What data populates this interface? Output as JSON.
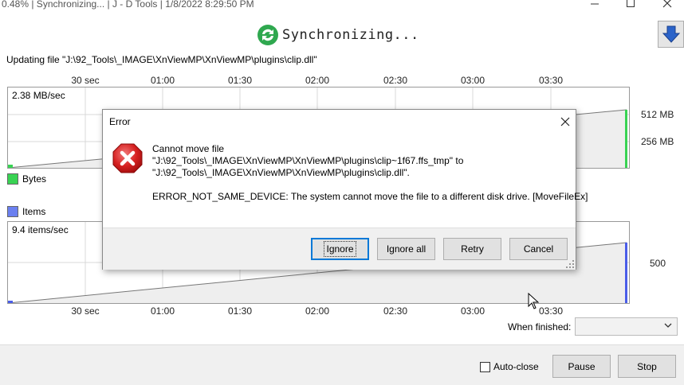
{
  "window": {
    "title": "0.48% | Synchronizing... | J - D Tools | 1/8/2022 8:29:50 PM",
    "minimize_icon": "minimize-icon",
    "maximize_icon": "maximize-icon",
    "close_icon": "close-icon"
  },
  "header": {
    "status_title": "Synchronizing...",
    "sync_icon": "sync-arrows-icon",
    "download_icon": "arrow-down-icon"
  },
  "progress": {
    "updating_text": "Updating file \"J:\\92_Tools\\_IMAGE\\XnViewMP\\XnViewMP\\plugins\\clip.dll\"",
    "time_ticks": [
      "30 sec",
      "01:00",
      "01:30",
      "02:00",
      "02:30",
      "03:00",
      "03:30"
    ],
    "bytes_graph": {
      "rate": "2.38 MB/sec",
      "legend": "Bytes",
      "color": "#39d353",
      "labels": [
        "512 MB",
        "256 MB"
      ]
    },
    "items_graph": {
      "rate": "9.4 items/sec",
      "legend": "Items",
      "color": "#4a5de8",
      "labels": [
        "500"
      ]
    }
  },
  "footer": {
    "when_finished_label": "When finished:",
    "when_finished_value": "",
    "auto_close_label": "Auto-close",
    "auto_close_checked": false,
    "pause_label": "Pause",
    "stop_label": "Stop"
  },
  "dialog": {
    "title": "Error",
    "icon": "error-x-icon",
    "line1": "Cannot move file",
    "line2": "\"J:\\92_Tools\\_IMAGE\\XnViewMP\\XnViewMP\\plugins\\clip~1f67.ffs_tmp\" to",
    "line3": "\"J:\\92_Tools\\_IMAGE\\XnViewMP\\XnViewMP\\plugins\\clip.dll\".",
    "error_text": "ERROR_NOT_SAME_DEVICE: The system cannot move the file to a different disk drive. [MoveFileEx]",
    "buttons": {
      "ignore": "Ignore",
      "ignore_all": "Ignore all",
      "retry": "Retry",
      "cancel": "Cancel"
    }
  }
}
